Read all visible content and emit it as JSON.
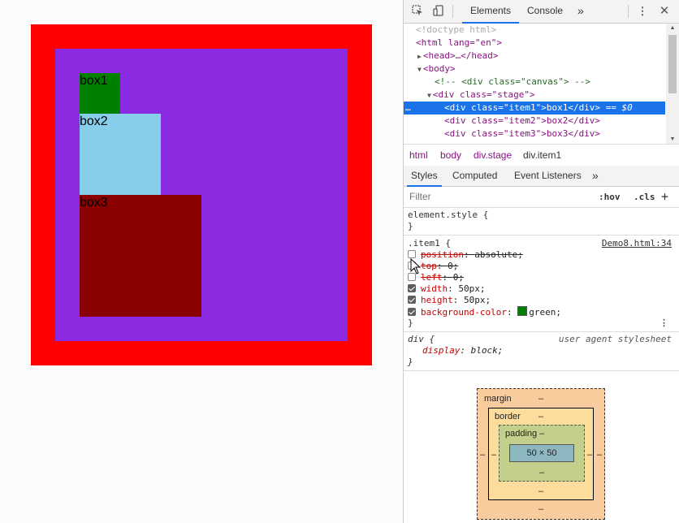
{
  "viewport": {
    "boxes": [
      {
        "label": "box1",
        "color": "#008000"
      },
      {
        "label": "box2",
        "color": "#87ceeb"
      },
      {
        "label": "box3",
        "color": "#8b0000"
      }
    ],
    "canvas_color": "#ff0000",
    "stage_color": "#8a2be2"
  },
  "devtools": {
    "tabs": [
      "Elements",
      "Console"
    ],
    "more": "»",
    "dom": {
      "doctype": "<!doctype html>",
      "html_open": "<html lang=\"en\">",
      "head": "<head>…</head>",
      "body": "<body>",
      "comment": "<!-- <div class=\"canvas\"> -->",
      "stage": "<div class=\"stage\">",
      "item1": "<div class=\"item1\">box1</div>",
      "item1_suffix": "== $0",
      "item2": "<div class=\"item2\">box2</div>",
      "item3": "<div class=\"item3\">box3</div>",
      "ellipsis": "…"
    },
    "breadcrumbs": [
      "html",
      "body",
      "div.stage",
      "div.item1"
    ],
    "subtabs": [
      "Styles",
      "Computed",
      "Event Listeners"
    ],
    "filter": {
      "placeholder": "Filter",
      "hov": ":hov",
      "cls": ".cls",
      "plus": "+"
    },
    "element_style": {
      "selector": "element.style {",
      "close": "}"
    },
    "item1_rule": {
      "selector": ".item1 {",
      "source": "Demo8.html:34",
      "decls": [
        {
          "prop": "position",
          "val": "absolute;",
          "checked": false
        },
        {
          "prop": "top",
          "val": "0;",
          "checked": false
        },
        {
          "prop": "left",
          "val": "0;",
          "checked": false
        },
        {
          "prop": "width",
          "val": "50px;",
          "checked": true
        },
        {
          "prop": "height",
          "val": "50px;",
          "checked": true
        },
        {
          "prop": "background-color",
          "val": "green;",
          "checked": true
        }
      ],
      "close": "}"
    },
    "ua_rule": {
      "selector": "div {",
      "source": "user agent stylesheet",
      "prop": "display",
      "val": "block;",
      "close": "}"
    },
    "box_model": {
      "margin_label": "margin",
      "border_label": "border",
      "padding_label": "padding",
      "content": "50 × 50",
      "dash": "–"
    }
  }
}
